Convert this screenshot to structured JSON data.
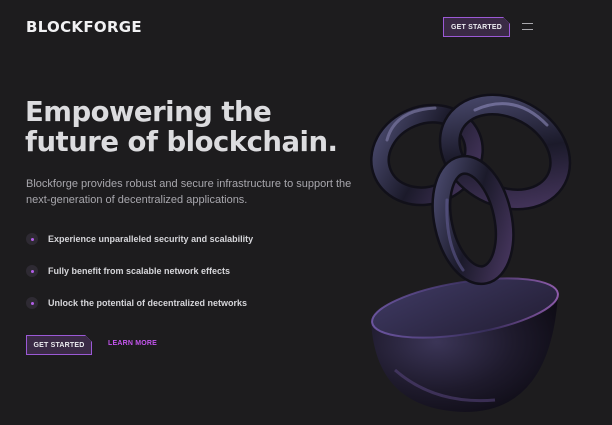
{
  "header": {
    "brand": "BLOCKFORGE",
    "cta_label": "GET STARTED"
  },
  "hero": {
    "title_line1": "Empowering the",
    "title_line2": "future of blockchain.",
    "description": "Blockforge provides robust and secure infrastructure to support the next-generation of decentralized applications.",
    "features": [
      "Experience unparalleled security and scalability",
      "Fully benefit from scalable network effects",
      "Unlock the potential of decentralized networks"
    ],
    "cta_label": "GET STARTED",
    "secondary_label": "LEARN MORE"
  },
  "colors": {
    "background": "#1d1c1e",
    "accent": "#9b59d6",
    "link": "#c455ee"
  },
  "icons": {
    "menu": "hamburger-menu-icon",
    "bullet": "dot-bullet-icon"
  }
}
